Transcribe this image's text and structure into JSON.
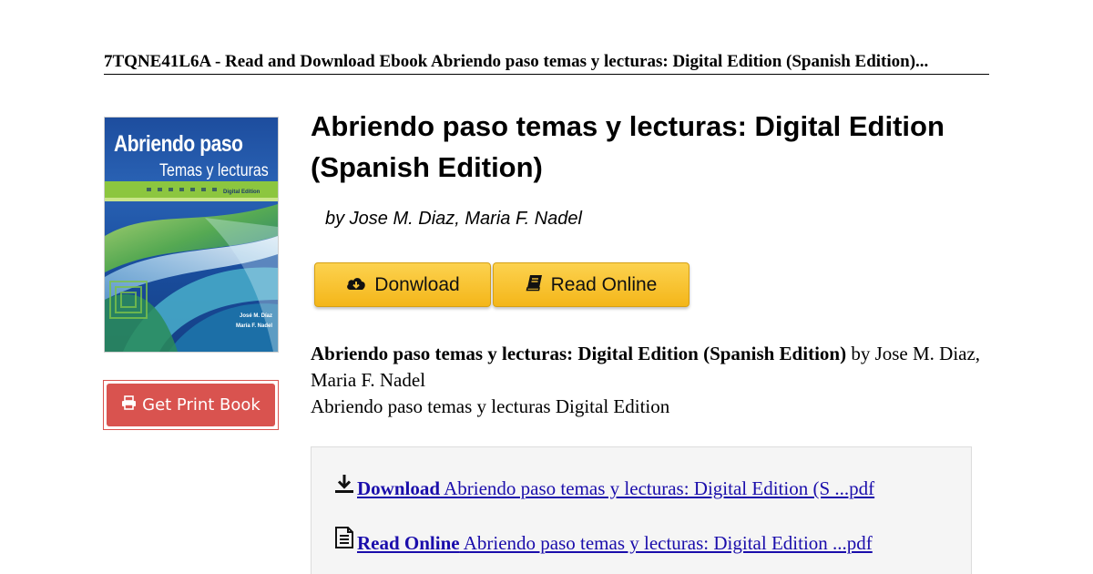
{
  "header": {
    "title": "7TQNE41L6A - Read and Download Ebook Abriendo paso temas y lecturas: Digital Edition (Spanish Edition)..."
  },
  "cover": {
    "title": "Abriendo paso",
    "subtitle": "Temas y lecturas",
    "edition": "Digital Edition",
    "author1": "José M. Díaz",
    "author2": "María F. Nadel",
    "colors": {
      "background": "#1f4fa3",
      "accent_green": "#8cc63f"
    }
  },
  "print_button": {
    "label": "Get Print Book",
    "icon": "print-icon",
    "color": "#d9534f"
  },
  "book": {
    "title": "Abriendo paso temas y lecturas: Digital Edition (Spanish Edition)",
    "authors": "by Jose M. Diaz, Maria F. Nadel"
  },
  "actions": {
    "download_label": "Donwload",
    "download_icon": "cloud-download-icon",
    "read_label": "Read Online",
    "read_icon": "book-icon",
    "color": "#f4b619"
  },
  "description": {
    "bold_title": "Abriendo paso temas y lecturas: Digital Edition (Spanish Edition)",
    "by_text": " by Jose M. Diaz, Maria F. Nadel",
    "line2": "Abriendo paso temas y lecturas Digital Edition"
  },
  "links": {
    "download_strong": "Download",
    "download_text": " Abriendo paso temas y lecturas: Digital Edition (S ...pdf",
    "download_icon": "download-arrow-icon",
    "read_strong": "Read Online",
    "read_text": " Abriendo paso temas y lecturas: Digital Edition ...pdf",
    "read_icon": "document-icon"
  }
}
